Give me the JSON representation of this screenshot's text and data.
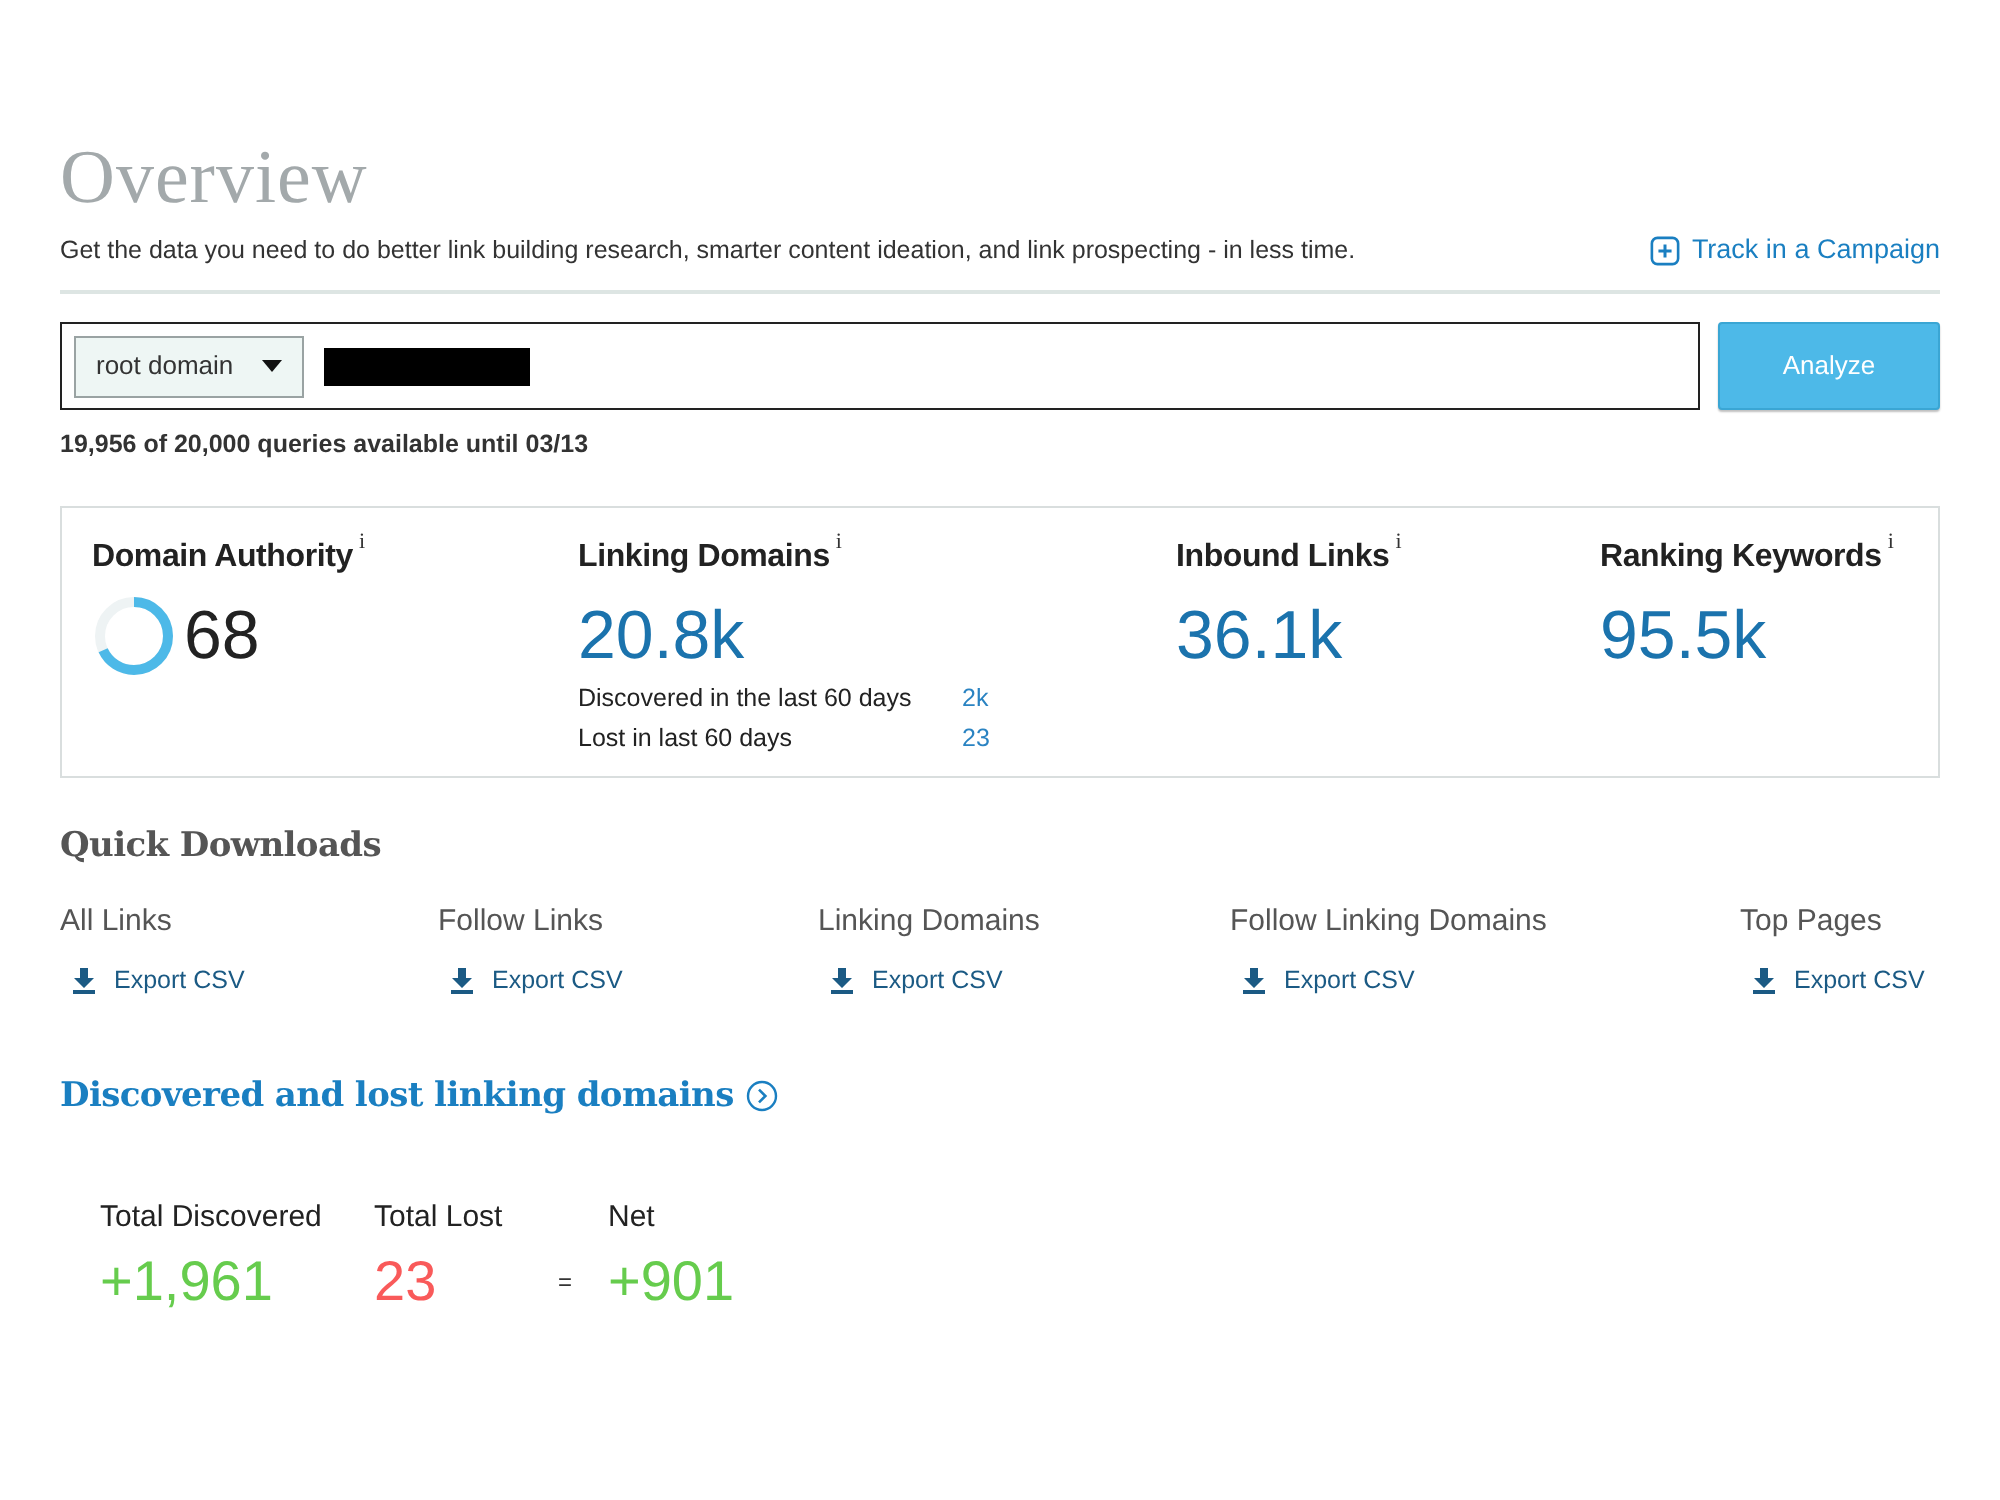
{
  "header": {
    "title": "Overview",
    "subtitle": "Get the data you need to do better link building research, smarter content ideation, and link prospecting - in less time.",
    "campaign_link": "Track in a Campaign"
  },
  "search": {
    "scope": "root domain",
    "button": "Analyze",
    "quota": "19,956 of 20,000 queries available until 03/13"
  },
  "metrics": [
    {
      "kind": "authority",
      "label": "Domain Authority",
      "info": "i",
      "value": "68",
      "level": 0.68
    },
    {
      "kind": "count",
      "label": "Linking Domains",
      "info": "i",
      "value": "20.8k",
      "details": [
        {
          "label": "Discovered in the last 60 days",
          "value": "2k"
        },
        {
          "label": "Lost in last 60 days",
          "value": "23"
        }
      ]
    },
    {
      "kind": "count",
      "label": "Inbound Links",
      "info": "i",
      "value": "36.1k"
    },
    {
      "kind": "count",
      "label": "Ranking Keywords",
      "info": "i",
      "value": "95.5k"
    }
  ],
  "quick_downloads": {
    "title": "Quick Downloads",
    "items": [
      {
        "label": "All Links",
        "action": "Export CSV"
      },
      {
        "label": "Follow Links",
        "action": "Export CSV"
      },
      {
        "label": "Linking Domains",
        "action": "Export CSV"
      },
      {
        "label": "Follow Linking Domains",
        "action": "Export CSV"
      },
      {
        "label": "Top Pages",
        "action": "Export CSV"
      }
    ]
  },
  "discovered_lost": {
    "title": "Discovered and lost linking domains",
    "totals": [
      {
        "label": "Total Discovered",
        "value": "+1,961",
        "color": "#66cc4d"
      },
      {
        "label": "Total Lost",
        "value": "23",
        "color": "#f95a5a"
      },
      {
        "label": "Net",
        "value": "+901",
        "color": "#66cc4d"
      }
    ],
    "equals": "="
  }
}
